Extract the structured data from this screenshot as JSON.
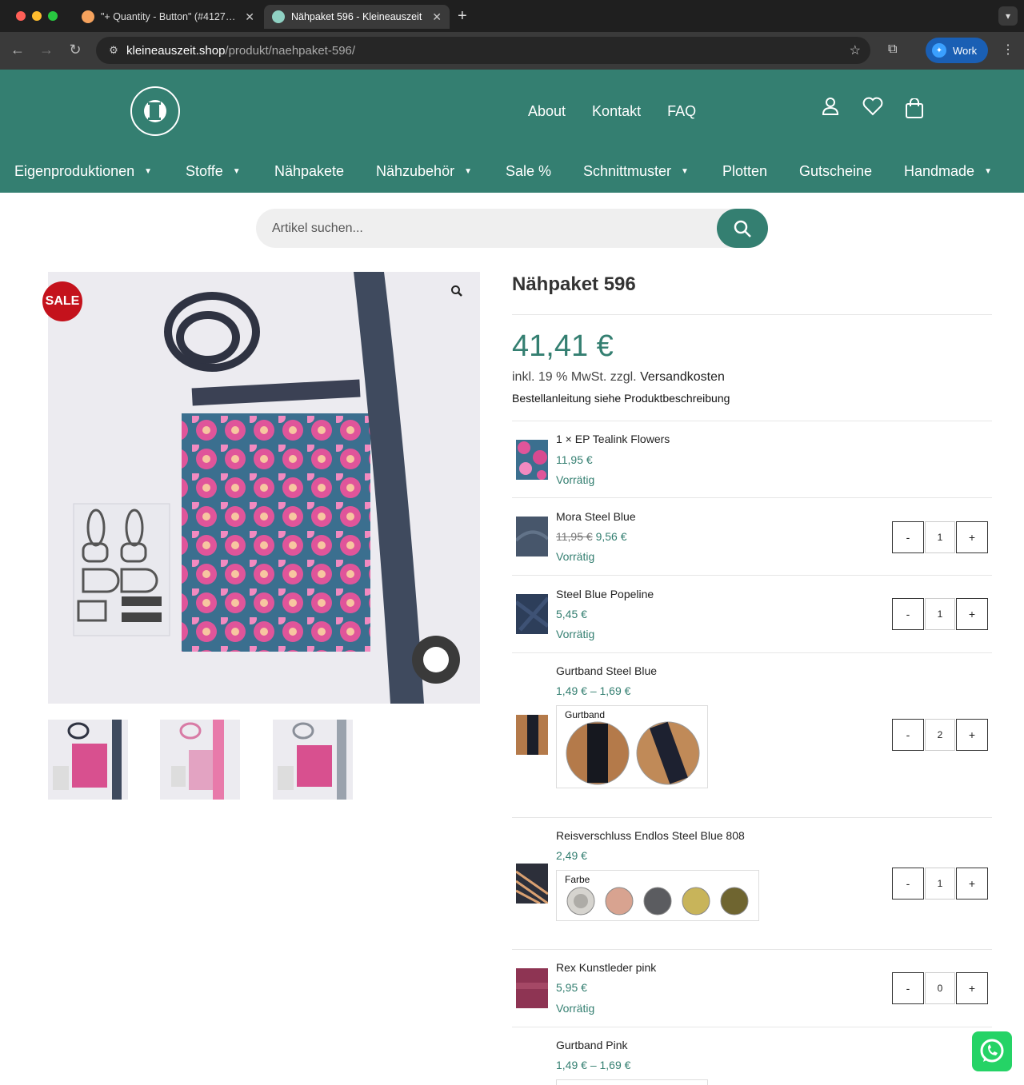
{
  "browser": {
    "tabs": [
      {
        "title": "\"+ Quantity - Button\" (#4127…",
        "active": false
      },
      {
        "title": "Nähpaket 596 - Kleineauszeit",
        "active": true
      }
    ],
    "url_domain": "kleineauszeit.shop",
    "url_path": "/produkt/naehpaket-596/",
    "profile": "Work"
  },
  "header": {
    "top_links": [
      "About",
      "Kontakt",
      "FAQ"
    ],
    "nav": [
      {
        "label": "Eigenproduktionen",
        "caret": true
      },
      {
        "label": "Stoffe",
        "caret": true
      },
      {
        "label": "Nähpakete",
        "caret": false
      },
      {
        "label": "Nähzubehör",
        "caret": true
      },
      {
        "label": "Sale %",
        "caret": false
      },
      {
        "label": "Schnittmuster",
        "caret": true
      },
      {
        "label": "Plotten",
        "caret": false
      },
      {
        "label": "Gutscheine",
        "caret": false
      },
      {
        "label": "Handmade",
        "caret": true
      }
    ]
  },
  "search": {
    "placeholder": "Artikel suchen..."
  },
  "gallery": {
    "sale_badge": "SALE"
  },
  "product": {
    "title": "Nähpaket 596",
    "price": "41,41 €",
    "tax_prefix": "inkl. 19 % MwSt. zzgl.",
    "tax_link": "Versandkosten",
    "note": "Bestellanleitung siehe Produktbeschreibung"
  },
  "items": [
    {
      "name": "1 × EP Tealink Flowers",
      "price": "11,95 €",
      "stock": "Vorrätig"
    },
    {
      "name": "Mora Steel Blue",
      "old_price": "11,95 €",
      "price": "9,56 €",
      "stock": "Vorrätig",
      "qty": "1"
    },
    {
      "name": "Steel Blue Popeline",
      "price": "5,45 €",
      "stock": "Vorrätig",
      "qty": "1"
    },
    {
      "name": "Gurtband Steel Blue",
      "price": "1,49 € – 1,69 €",
      "option_label": "Gurtband",
      "qty": "2"
    },
    {
      "name": "Reisverschluss Endlos Steel Blue 808",
      "price": "2,49 €",
      "option_label": "Farbe",
      "qty": "1"
    },
    {
      "name": "Rex Kunstleder pink",
      "price": "5,95 €",
      "stock": "Vorrätig",
      "qty": "0"
    },
    {
      "name": "Gurtband Pink",
      "price": "1,49 € – 1,69 €"
    }
  ],
  "qty_minus": "-",
  "qty_plus": "+",
  "colors": {
    "brand": "#347f71",
    "sale": "#c4121c"
  }
}
